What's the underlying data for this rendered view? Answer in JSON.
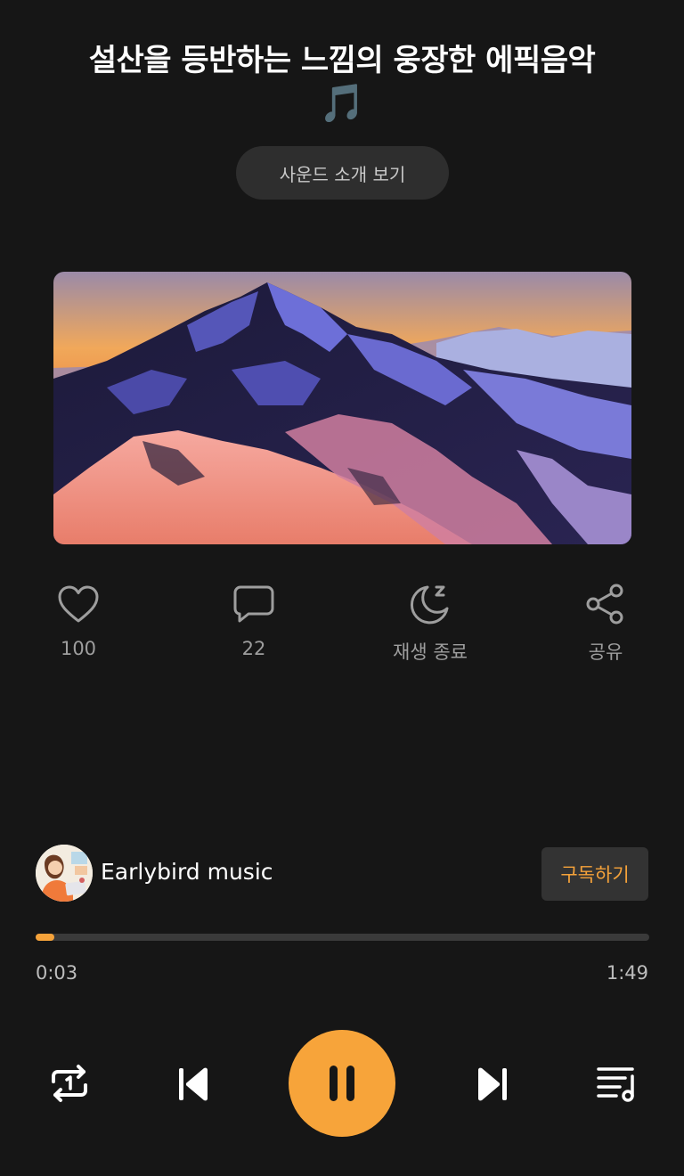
{
  "header": {
    "title": "설산을 등반하는 느낌의 웅장한 에픽음악",
    "title_emoji": "🎵"
  },
  "intro_button": {
    "label": "사운드 소개 보기"
  },
  "actions": {
    "like": {
      "label": "100",
      "icon": "heart-icon"
    },
    "comment": {
      "label": "22",
      "icon": "speech-bubble-icon"
    },
    "sleep_timer": {
      "label": "재생 종료",
      "icon": "moon-zzz-icon"
    },
    "share": {
      "label": "공유",
      "icon": "share-icon"
    }
  },
  "channel": {
    "name": "Earlybird music",
    "subscribe_label": "구독하기"
  },
  "player": {
    "current_time": "0:03",
    "total_time": "1:49",
    "progress": 0.03
  },
  "controls": {
    "repeat": "repeat-one-icon",
    "previous": "skip-previous-icon",
    "play_pause": "pause-icon",
    "next": "skip-next-icon",
    "playlist": "playlist-icon"
  },
  "colors": {
    "accent": "#f7a43a",
    "background": "#161616",
    "muted_text": "#9e9e9e"
  }
}
